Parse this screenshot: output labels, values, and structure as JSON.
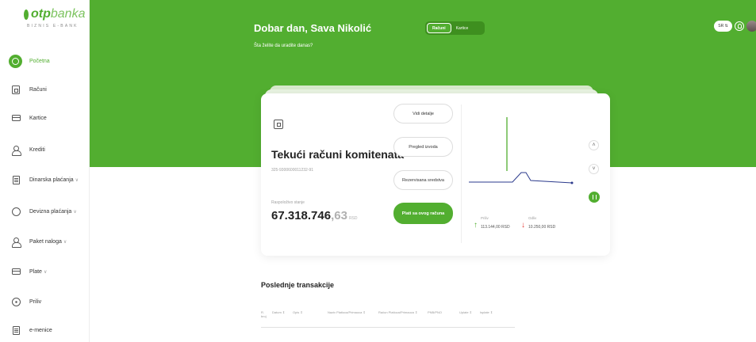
{
  "brand": {
    "name_bold": "otp",
    "name_light": "banka",
    "subtitle": "BIZNIS E-BANK"
  },
  "sidebar": {
    "items": [
      {
        "label": "Početna",
        "icon": "home-icon",
        "chevron": ""
      },
      {
        "label": "Računi",
        "icon": "account-icon",
        "chevron": ""
      },
      {
        "label": "Kartice",
        "icon": "card-icon",
        "chevron": ""
      },
      {
        "label": "Krediti",
        "icon": "loan-icon",
        "chevron": ""
      },
      {
        "label": "Dinarska plaćanja",
        "icon": "dinar-payment-icon",
        "chevron": "∨"
      },
      {
        "label": "Devizna plaćanja",
        "icon": "foreign-payment-icon",
        "chevron": "∨"
      },
      {
        "label": "Paket naloga",
        "icon": "package-icon",
        "chevron": "∨"
      },
      {
        "label": "Plate",
        "icon": "salary-icon",
        "chevron": "∨"
      },
      {
        "label": "Priliv",
        "icon": "inflow-icon",
        "chevron": ""
      },
      {
        "label": "e-menice",
        "icon": "e-bill-icon",
        "chevron": ""
      }
    ]
  },
  "header": {
    "greeting": "Dobar dan, Sava Nikolić",
    "subtitle": "Šta želite da uradite danas?",
    "toggle": {
      "left": "Računi",
      "right": "Kartice"
    },
    "language": "SR ⇅"
  },
  "account_card": {
    "title": "Tekući računi komitenata",
    "number": "325-9300600011232-91",
    "balance_label": "Raspoloživo stanje",
    "balance_int": "67.318.746",
    "balance_dec": ",63",
    "currency": "RSD",
    "actions": [
      "Vidi detalje",
      "Pregled izvoda",
      "Rezervisana sredstva",
      "Plati sa ovog računa"
    ],
    "inflow": {
      "label": "Priliv",
      "value": "113.144,00 RSD"
    },
    "outflow": {
      "label": "Odliv",
      "value": "10.250,00 RSD"
    },
    "nav": {
      "up": "˄",
      "down": "˅"
    }
  },
  "transactions": {
    "title": "Poslednje transakcije",
    "columns": [
      "R. broj",
      "Datum ⇕",
      "Opis ⇕",
      "Naziv Platioca/Primaoca ⇕",
      "Račun Platioca/Primaoca ⇕",
      "PNB/PNO",
      "Uplate ⇕",
      "Isplate ⇕"
    ]
  },
  "colors": {
    "brand_green": "#52ae30",
    "inflow": "#52ae30",
    "outflow": "#e53935",
    "chart_line": "#2b3a8c"
  }
}
